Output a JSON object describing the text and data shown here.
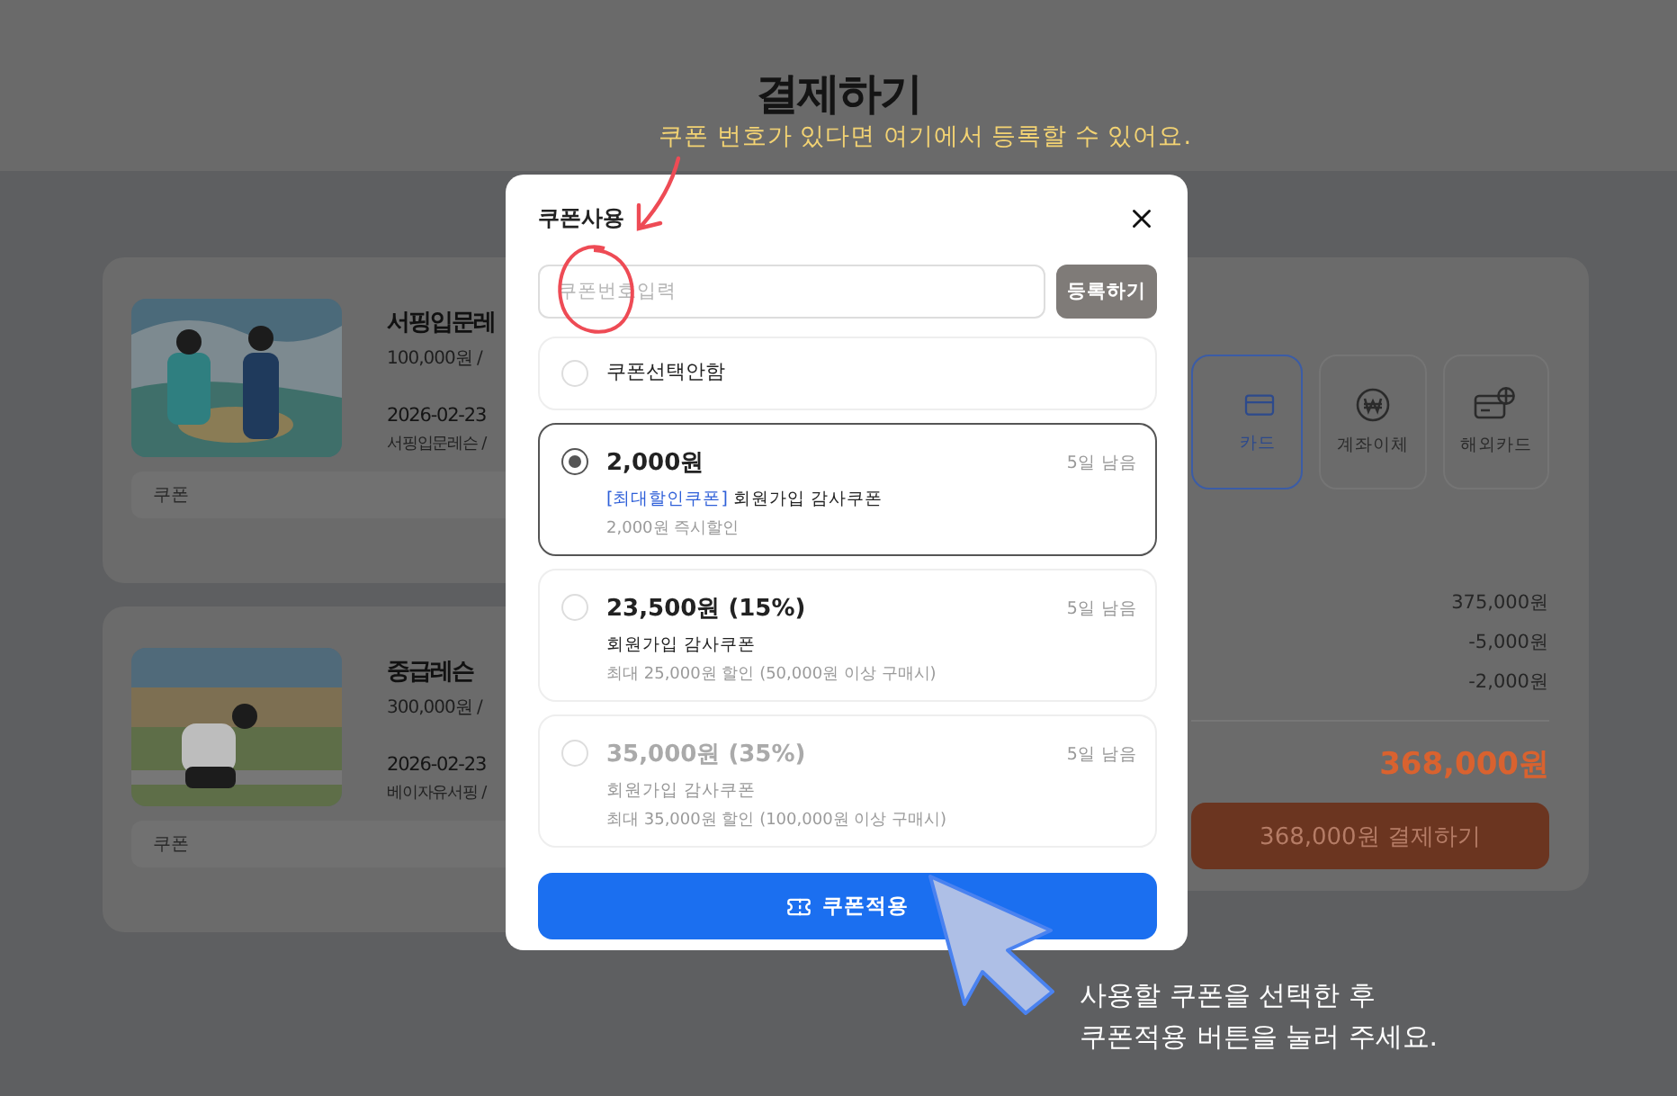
{
  "page": {
    "title": "결제하기"
  },
  "orders": [
    {
      "title": "서핑입문레",
      "price": "100,000원 /",
      "date": "2026-02-23",
      "detail": "서핑입문레슨 /",
      "coupon_label": "쿠폰"
    },
    {
      "title": "중급레슨",
      "price": "300,000원 /",
      "date": "2026-02-23",
      "detail": "베이자유서핑 /",
      "coupon_label": "쿠폰"
    }
  ],
  "payment": {
    "methods": [
      {
        "label": "카드",
        "kind": "card",
        "selected": true
      },
      {
        "label": "계좌이체",
        "kind": "transfer",
        "selected": false
      },
      {
        "label": "해외카드",
        "kind": "global",
        "selected": false
      }
    ],
    "amounts": [
      "375,000원",
      "-5,000원",
      "-2,000원"
    ],
    "total": "368,000원",
    "pay_button": "368,000원 결제하기"
  },
  "modal": {
    "title": "쿠폰사용",
    "code_field": {
      "placeholder": "쿠폰번호입력"
    },
    "register_button": "등록하기",
    "options": [
      {
        "amount": "쿠폰선택안함",
        "selected": false,
        "disabled": false
      },
      {
        "amount": "2,000원",
        "remaining": "5일 남음",
        "tag": "[최대할인쿠폰]",
        "name": "회원가입 감사쿠폰",
        "note": "2,000원 즉시할인",
        "selected": true,
        "disabled": false
      },
      {
        "amount": "23,500원 (15%)",
        "remaining": "5일 남음",
        "name": "회원가입 감사쿠폰",
        "note": "최대 25,000원 할인 (50,000원 이상 구매시)",
        "selected": false,
        "disabled": false
      },
      {
        "amount": "35,000원 (35%)",
        "remaining": "5일 남음",
        "name": "회원가입 감사쿠폰",
        "note": "최대 35,000원 할인 (100,000원 이상 구매시)",
        "selected": false,
        "disabled": true
      }
    ],
    "apply_button": "쿠폰적용"
  },
  "annotations": {
    "top_hint": "쿠폰 번호가 있다면 여기에서 등록할 수 있어요.",
    "bottom_hint": [
      "사용할 쿠폰을 선택한 후",
      "쿠폰적용 버튼을 눌러 주세요."
    ]
  }
}
